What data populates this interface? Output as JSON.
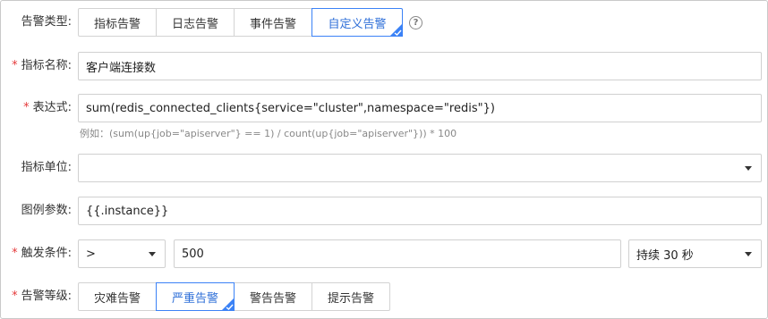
{
  "alert_type": {
    "label": "告警类型:",
    "options": [
      "指标告警",
      "日志告警",
      "事件告警",
      "自定义告警"
    ],
    "selected": "自定义告警"
  },
  "help_icon_glyph": "?",
  "metric_name": {
    "label": "指标名称:",
    "value": "客户端连接数"
  },
  "expression": {
    "label": "表达式:",
    "value": "sum(redis_connected_clients{service=\"cluster\",namespace=\"redis\"})",
    "example": "例如：(sum(up{job=\"apiserver\"} == 1) / count(up{job=\"apiserver\"})) * 100"
  },
  "metric_unit": {
    "label": "指标单位:",
    "value": ""
  },
  "legend": {
    "label": "图例参数:",
    "value": "{{.instance}}"
  },
  "trigger": {
    "label": "触发条件:",
    "operator": ">",
    "threshold": "500",
    "duration": "持续 30 秒"
  },
  "severity": {
    "label": "告警等级:",
    "options": [
      "灾难告警",
      "严重告警",
      "警告告警",
      "提示告警"
    ],
    "selected": "严重告警"
  },
  "colors": {
    "accent": "#3b82f6",
    "required": "#e5393a",
    "border": "#d0d0d0"
  },
  "required_mark": "*"
}
